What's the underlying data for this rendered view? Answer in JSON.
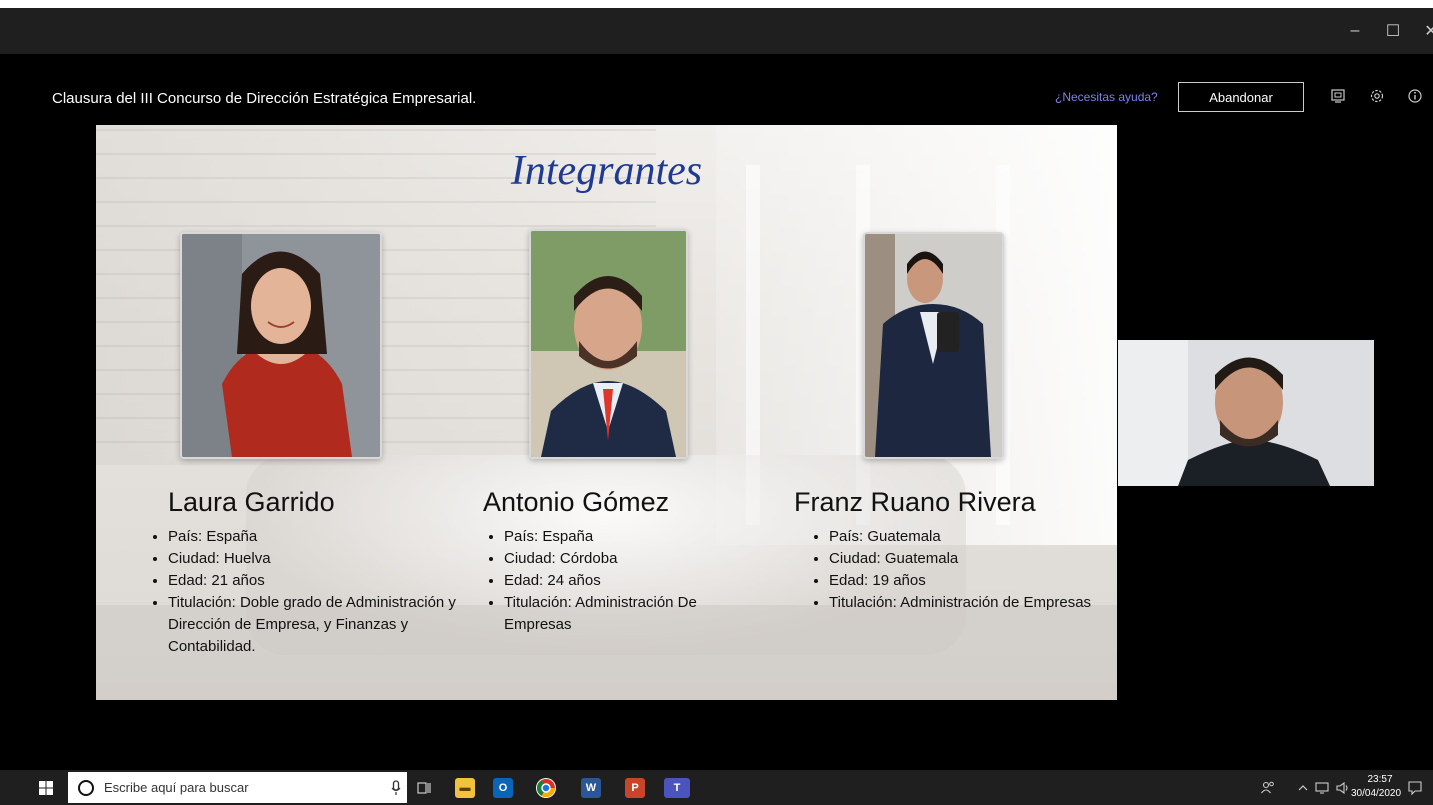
{
  "meeting": {
    "title": "Clausura del III Concurso de Dirección Estratégica Empresarial.",
    "help_link": "¿Necesitas ayuda?",
    "leave_label": "Abandonar"
  },
  "slide": {
    "title": "Integrantes",
    "members": [
      {
        "name": "Laura Garrido",
        "details": [
          "País: España",
          "Ciudad: Huelva",
          "Edad: 21 años",
          "Titulación: Doble grado de Administración y Dirección de Empresa, y Finanzas y Contabilidad."
        ]
      },
      {
        "name": "Antonio Gómez",
        "details": [
          "País: España",
          "Ciudad: Córdoba",
          "Edad: 24 años",
          "Titulación: Administración De Empresas"
        ]
      },
      {
        "name": "Franz Ruano Rivera",
        "details": [
          "País: Guatemala",
          "Ciudad: Guatemala",
          "Edad: 19 años",
          "Titulación: Administración de Empresas"
        ]
      }
    ]
  },
  "taskbar": {
    "search_placeholder": "Escribe aquí para buscar",
    "time": "23:57",
    "date": "30/04/2020",
    "apps": [
      "task-view-icon",
      "file-explorer-icon",
      "outlook-icon",
      "chrome-icon",
      "word-icon",
      "powerpoint-icon",
      "teams-icon"
    ]
  },
  "colors": {
    "accent": "#7b83eb",
    "slide_title": "#1f3a93",
    "taskbar": "#1f1f1f",
    "titlebar": "#1f1f1f"
  }
}
